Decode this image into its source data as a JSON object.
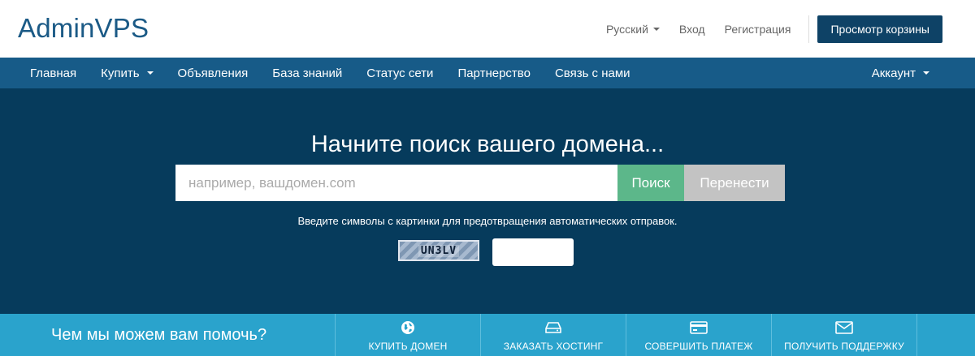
{
  "header": {
    "logo": "AdminVPS",
    "language": "Русский",
    "login": "Вход",
    "register": "Регистрация",
    "cart_button": "Просмотр корзины"
  },
  "nav": {
    "items": [
      {
        "label": "Главная"
      },
      {
        "label": "Купить"
      },
      {
        "label": "Объявления"
      },
      {
        "label": "База знаний"
      },
      {
        "label": "Статус сети"
      },
      {
        "label": "Партнерство"
      },
      {
        "label": "Связь с нами"
      }
    ],
    "account": "Аккаунт"
  },
  "hero": {
    "title": "Начните поиск вашего домена...",
    "search_placeholder": "например, вашдомен.com",
    "search_button": "Поиск",
    "transfer_button": "Перенести",
    "captcha_instruction": "Введите символы с картинки для предотвращения автоматических отправок.",
    "captcha_code": "UN3LV"
  },
  "help": {
    "title": "Чем мы можем вам помочь?",
    "items": [
      {
        "label": "КУПИТЬ ДОМЕН",
        "icon": "globe-icon"
      },
      {
        "label": "ЗАКАЗАТЬ ХОСТИНГ",
        "icon": "hdd-icon"
      },
      {
        "label": "СОВЕРШИТЬ ПЛАТЕЖ",
        "icon": "credit-card-icon"
      },
      {
        "label": "ПОЛУЧИТЬ ПОДДЕРЖКУ",
        "icon": "envelope-icon"
      }
    ]
  },
  "colors": {
    "brand": "#1b5a86",
    "navbar": "#175b88",
    "hero_bg": "#063b5c",
    "search_green": "#5cb78a",
    "helpbar": "#2aa3cc"
  }
}
